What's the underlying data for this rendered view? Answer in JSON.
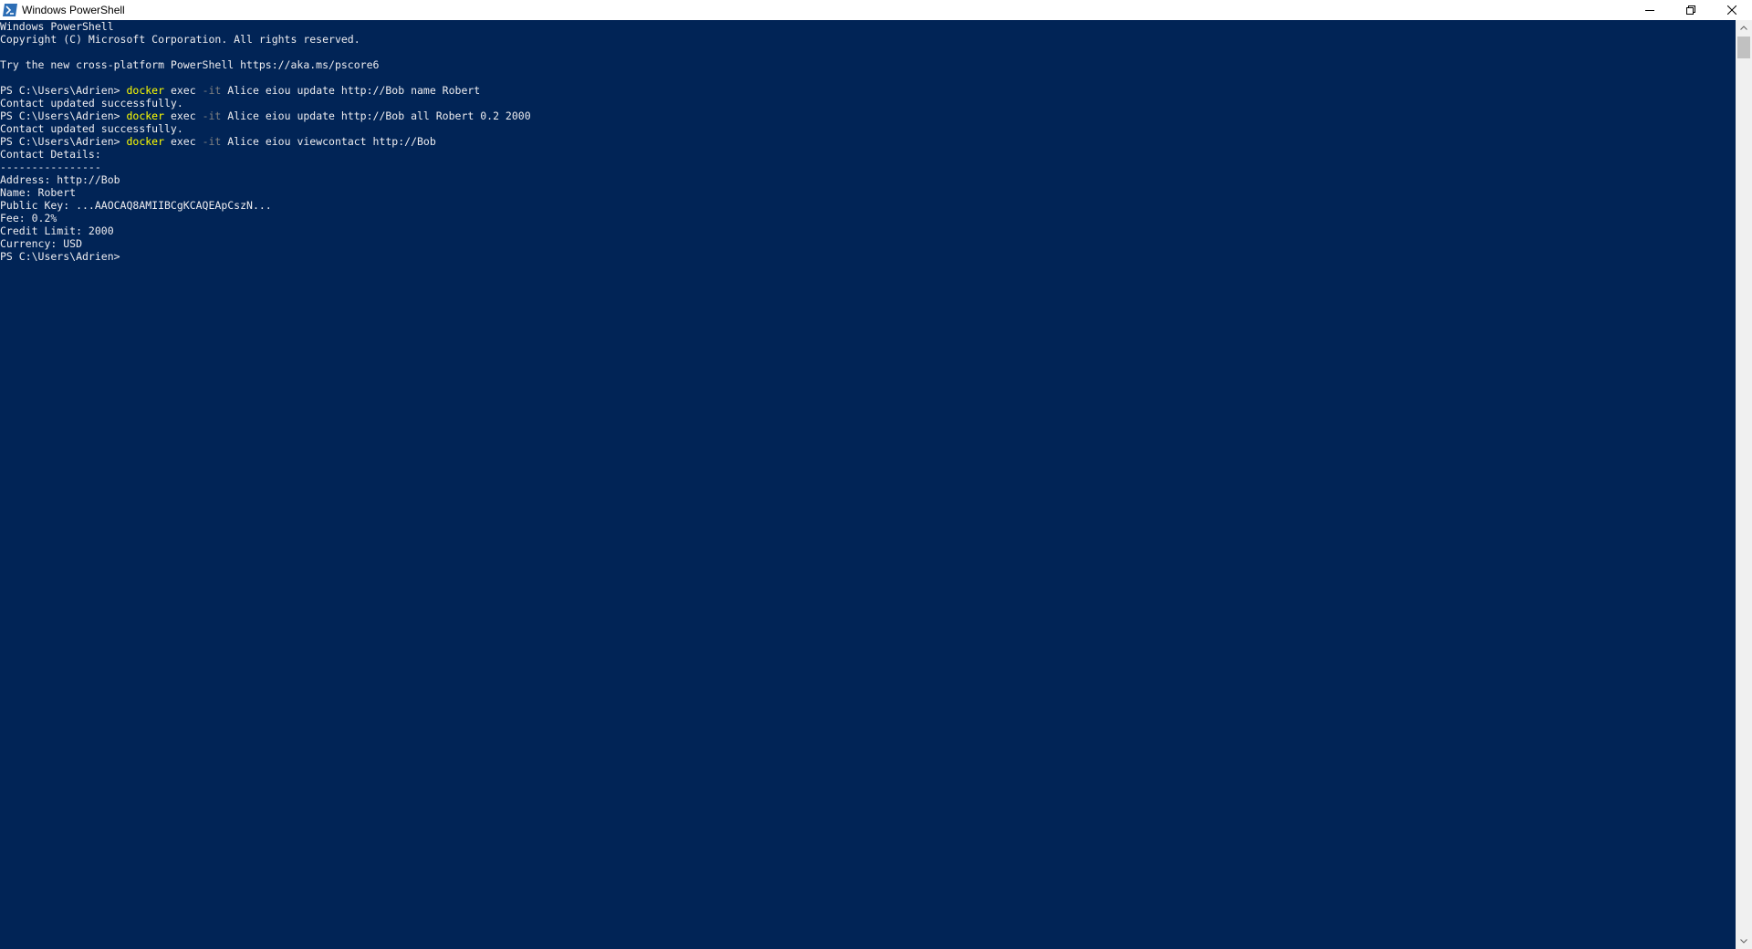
{
  "window": {
    "title": "Windows PowerShell",
    "icon": "powershell-icon",
    "colors": {
      "background": "#012456",
      "text": "#eeedf0",
      "command": "#ffff00",
      "parameter": "#808080"
    }
  },
  "titlebar_buttons": {
    "minimize_icon": "minimize-icon",
    "restore_icon": "restore-icon",
    "close_icon": "close-icon"
  },
  "console": {
    "banner": [
      "Windows PowerShell",
      "Copyright (C) Microsoft Corporation. All rights reserved.",
      "",
      "Try the new cross-platform PowerShell https://aka.ms/pscore6",
      ""
    ],
    "prompt": "PS C:\\Users\\Adrien> ",
    "commands": [
      {
        "cmd": "docker",
        "pre": " exec ",
        "param": "-it",
        "post": " Alice eiou update http://Bob name Robert",
        "output": [
          "Contact updated successfully."
        ]
      },
      {
        "cmd": "docker",
        "pre": " exec ",
        "param": "-it",
        "post": " Alice eiou update http://Bob all Robert 0.2 2000",
        "output": [
          "Contact updated successfully."
        ]
      },
      {
        "cmd": "docker",
        "pre": " exec ",
        "param": "-it",
        "post": " Alice eiou viewcontact http://Bob",
        "output": [
          "Contact Details:",
          "----------------",
          "Address: http://Bob",
          "Name: Robert",
          "Public Key: ...AAOCAQ8AMIIBCgKCAQEApCszN...",
          "Fee: 0.2%",
          "Credit Limit: 2000",
          "Currency: USD"
        ]
      }
    ],
    "final_prompt": "PS C:\\Users\\Adrien>"
  }
}
